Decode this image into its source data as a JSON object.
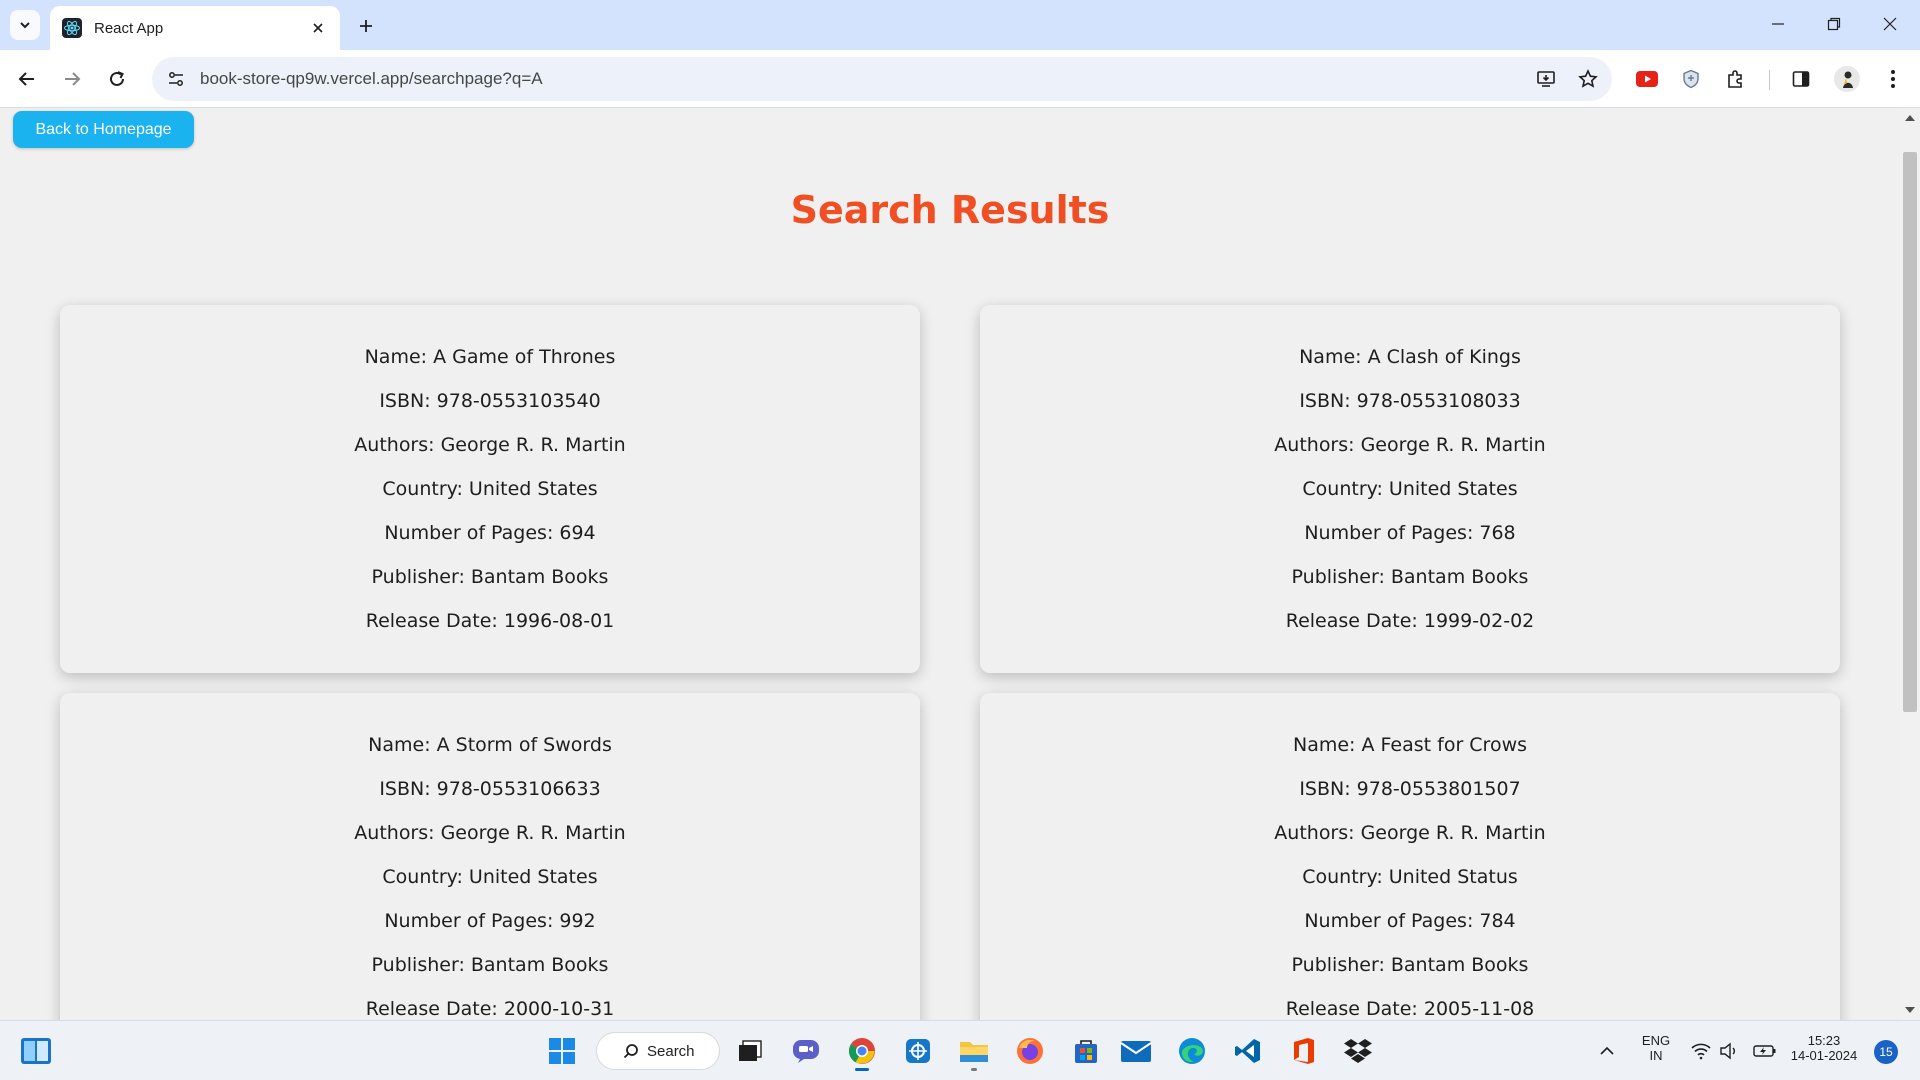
{
  "browser": {
    "tab_title": "React App",
    "url": "book-store-qp9w.vercel.app/searchpage?q=A"
  },
  "page": {
    "back_button_label": "Back to Homepage",
    "title": "Search Results",
    "title_color": "#f04e23",
    "button_color": "#1ab3f0",
    "books": [
      {
        "name": "Name: A Game of Thrones",
        "isbn": "ISBN: 978-0553103540",
        "authors": "Authors: George R. R. Martin",
        "country": "Country: United States",
        "pages": "Number of Pages: 694",
        "publisher": "Publisher: Bantam Books",
        "release": "Release Date: 1996-08-01"
      },
      {
        "name": "Name: A Clash of Kings",
        "isbn": "ISBN: 978-0553108033",
        "authors": "Authors: George R. R. Martin",
        "country": "Country: United States",
        "pages": "Number of Pages: 768",
        "publisher": "Publisher: Bantam Books",
        "release": "Release Date: 1999-02-02"
      },
      {
        "name": "Name: A Storm of Swords",
        "isbn": "ISBN: 978-0553106633",
        "authors": "Authors: George R. R. Martin",
        "country": "Country: United States",
        "pages": "Number of Pages: 992",
        "publisher": "Publisher: Bantam Books",
        "release": "Release Date: 2000-10-31"
      },
      {
        "name": "Name: A Feast for Crows",
        "isbn": "ISBN: 978-0553801507",
        "authors": "Authors: George R. R. Martin",
        "country": "Country: United Status",
        "pages": "Number of Pages: 784",
        "publisher": "Publisher: Bantam Books",
        "release": "Release Date: 2005-11-08"
      }
    ]
  },
  "taskbar": {
    "search_label": "Search",
    "language_line1": "ENG",
    "language_line2": "IN",
    "time": "15:23",
    "date": "14-01-2024",
    "notification_count": "15"
  }
}
